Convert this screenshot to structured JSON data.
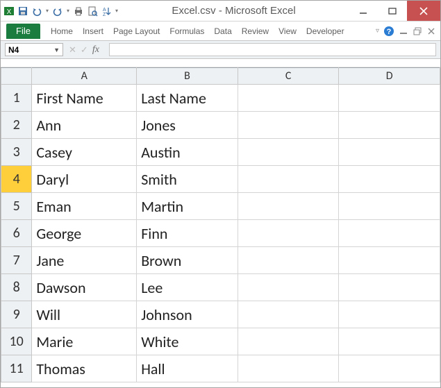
{
  "window": {
    "title": "Excel.csv - Microsoft Excel"
  },
  "ribbon": {
    "file": "File",
    "tabs": [
      "Home",
      "Insert",
      "Page Layout",
      "Formulas",
      "Data",
      "Review",
      "View",
      "Developer"
    ]
  },
  "formula_bar": {
    "name_box": "N4",
    "fx": "fx",
    "formula": ""
  },
  "grid": {
    "columns": [
      "A",
      "B",
      "C",
      "D"
    ],
    "active_row": 4,
    "rows": [
      {
        "n": 1,
        "A": "First Name",
        "B": "Last Name"
      },
      {
        "n": 2,
        "A": "Ann",
        "B": "Jones"
      },
      {
        "n": 3,
        "A": "Casey",
        "B": "Austin"
      },
      {
        "n": 4,
        "A": "Daryl",
        "B": "Smith"
      },
      {
        "n": 5,
        "A": "Eman",
        "B": "Martin"
      },
      {
        "n": 6,
        "A": "George",
        "B": "Finn"
      },
      {
        "n": 7,
        "A": "Jane",
        "B": "Brown"
      },
      {
        "n": 8,
        "A": "Dawson",
        "B": "Lee"
      },
      {
        "n": 9,
        "A": "Will",
        "B": "Johnson"
      },
      {
        "n": 10,
        "A": "Marie",
        "B": "White"
      },
      {
        "n": 11,
        "A": "Thomas",
        "B": "Hall"
      }
    ]
  }
}
